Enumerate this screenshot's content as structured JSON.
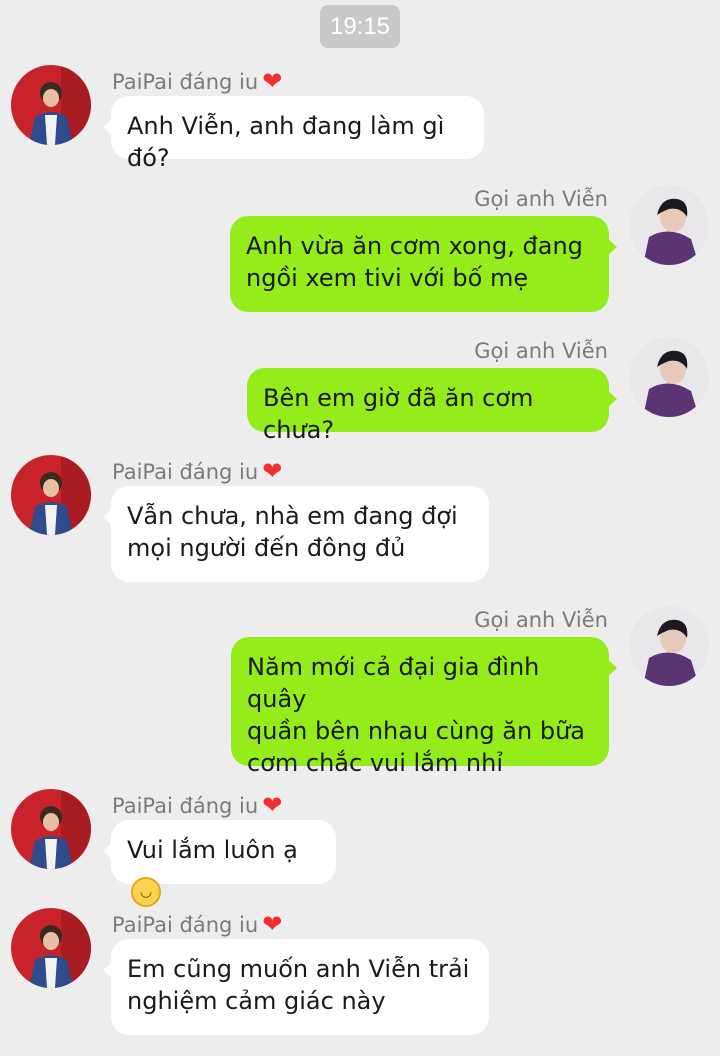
{
  "timestamp": "19:15",
  "contacts": {
    "her": {
      "name": "PaiPai đáng iu",
      "heart_icon": "red-heart-icon",
      "avatar_icon": "avatar-photo-red-wall"
    },
    "him": {
      "name": "Gọi anh Viễn",
      "avatar_icon": "avatar-photo-purple-shirt"
    }
  },
  "messages": [
    {
      "from": "her",
      "lines": [
        "Anh Viễn, anh đang làm gì đó?"
      ]
    },
    {
      "from": "him",
      "lines": [
        "Anh vừa ăn cơm xong, đang",
        "ngồi xem tivi với bố mẹ"
      ]
    },
    {
      "from": "him",
      "lines": [
        "Bên em giờ đã ăn cơm chưa?"
      ]
    },
    {
      "from": "her",
      "lines": [
        "Vẫn chưa, nhà em đang đợi",
        "mọi người đến đông đủ"
      ]
    },
    {
      "from": "him",
      "lines": [
        "Năm mới cả đại gia đình quây",
        "quần bên nhau cùng ăn bữa",
        "cơm chắc vui lắm nhỉ"
      ]
    },
    {
      "from": "her",
      "lines": [
        "Vui lắm luôn ạ"
      ],
      "emoji": "smiling-face-emoji"
    },
    {
      "from": "her",
      "lines": [
        "Em cũng muốn anh Viễn trải",
        "nghiệm cảm giác này"
      ]
    }
  ],
  "colors": {
    "background": "#ededed",
    "outgoing_bubble": "#95ec1b",
    "incoming_bubble": "#ffffff",
    "name_text": "#7b7b7b",
    "heart": "#f22e2e",
    "timestamp_pill": "#c9c9c9"
  }
}
